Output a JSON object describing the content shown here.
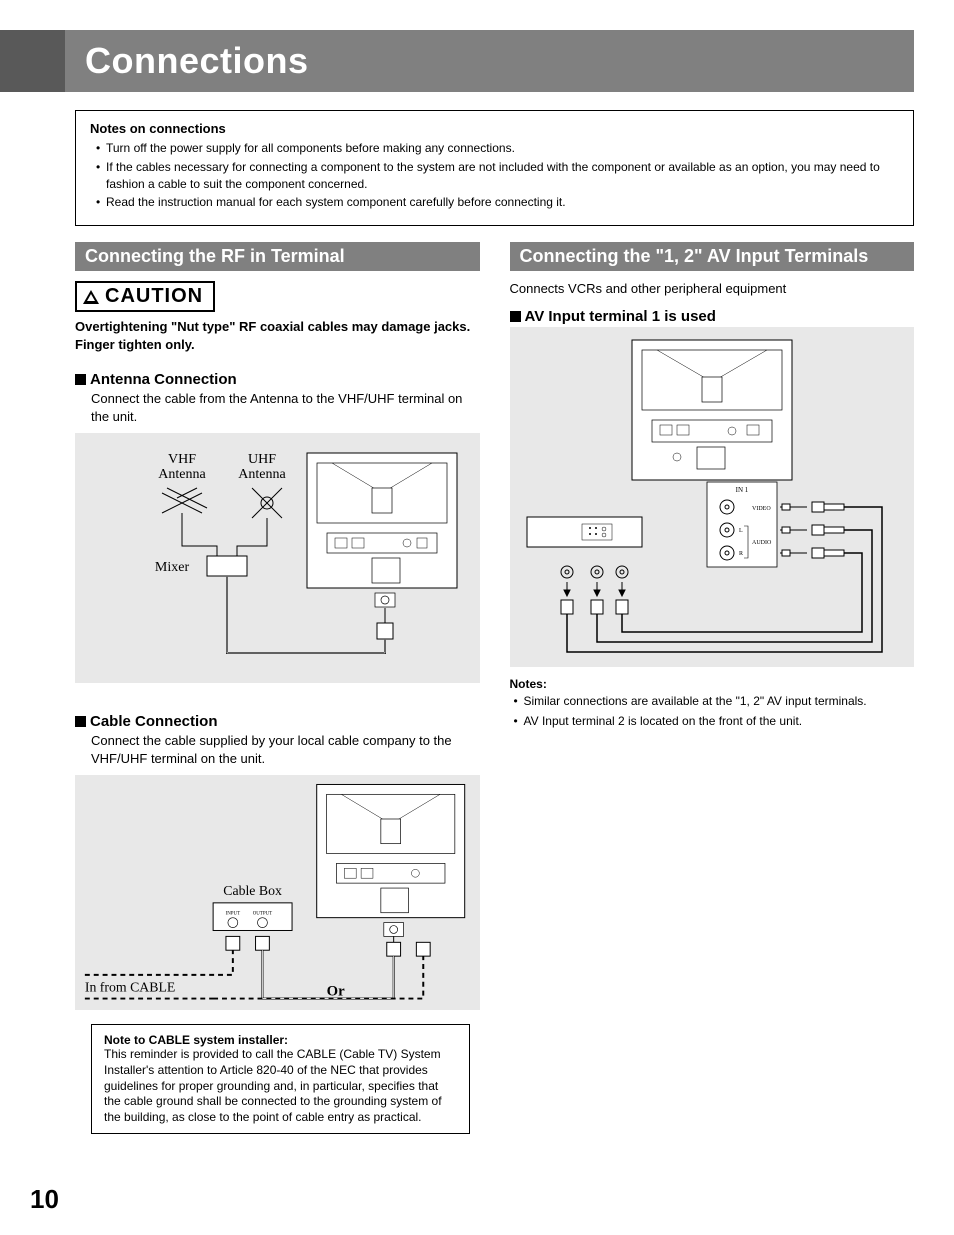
{
  "title": "Connections",
  "notesBox": {
    "heading": "Notes on connections",
    "items": [
      "Turn off the power supply for all components before making any connections.",
      "If the cables necessary for connecting a component to the system are not included with the component or available as an option, you may need to fashion a cable to suit the component concerned.",
      "Read the instruction manual for each system component carefully before connecting it."
    ]
  },
  "left": {
    "sectionTitle": "Connecting the RF in Terminal",
    "cautionLabel": "CAUTION",
    "cautionText": "Overtightening \"Nut type\" RF coaxial cables may damage jacks. Finger tighten only.",
    "antenna": {
      "heading": "Antenna Connection",
      "desc": "Connect the cable from the Antenna to the VHF/UHF terminal on the unit.",
      "labels": {
        "vhf": "VHF Antenna",
        "uhf": "UHF Antenna",
        "mixer": "Mixer"
      }
    },
    "cable": {
      "heading": "Cable Connection",
      "desc": "Connect the cable supplied by your local cable company to the VHF/UHF terminal on the unit.",
      "labels": {
        "cableBox": "Cable Box",
        "inFrom": "In from CABLE",
        "or": "Or"
      }
    },
    "installer": {
      "heading": "Note to CABLE system installer:",
      "body": "This reminder is provided to call the CABLE (Cable TV) System Installer's attention to Article 820-40 of the NEC that provides guidelines for proper grounding and, in particular, specifies that the cable ground shall be connected to the grounding system of the building, as close to the point of cable entry as practical."
    }
  },
  "right": {
    "sectionTitle": "Connecting the \"1, 2\" AV Input Terminals",
    "intro": "Connects VCRs and other peripheral equipment",
    "avInput": {
      "heading": "AV Input terminal 1 is used",
      "labels": {
        "in1": "IN 1",
        "video": "VIDEO",
        "audio": "AUDIO",
        "l": "L",
        "r": "R"
      }
    },
    "notes": {
      "heading": "Notes:",
      "items": [
        "Similar connections are available at the \"1, 2\" AV input terminals.",
        "AV Input terminal 2 is located on the front of the unit."
      ]
    }
  },
  "pageNumber": "10"
}
